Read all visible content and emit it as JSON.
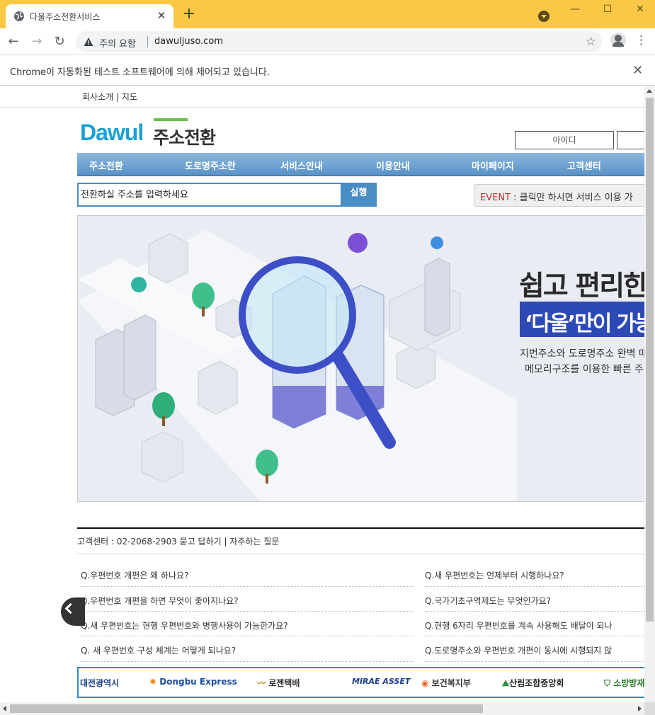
{
  "browser": {
    "tab_title": "다울주소전환서비스",
    "tab_close": "✕",
    "new_tab": "+",
    "security_warning": "주의 요함",
    "url": "dawuljuso.com",
    "infobar_text": "Chrome이 자동화된 테스트 소프트웨어에 의해 제어되고 있습니다.",
    "infobar_close": "✕"
  },
  "site": {
    "top_links": [
      "회사소개",
      "지도"
    ],
    "top_links_sep": " | ",
    "logo_en": "Dawul",
    "logo_ko": "주소전환",
    "login_id_label": "아이디",
    "nav": [
      "주소전환",
      "도로명주소란",
      "서비스안내",
      "이용안내",
      "마이페이지",
      "고객센터"
    ],
    "search_placeholder": "전환하실 주소를 입력하세요",
    "search_button": "실행",
    "event_label": "EVENT",
    "event_text": " : 클릭만 하시면 서비스 이용 가",
    "banner": {
      "headline1": "쉽고 편리한",
      "headline2": "‘다울’만이 가능한",
      "sub1": "지번주소와 도로명주소 완벽 매",
      "sub2": "메모리구조를 이용한 빠른 주"
    },
    "cs_text": "고객센터 : 02-2068-2903 묻고 답하기 | 자주하는 질문",
    "faq_left": [
      "Q.우편번호 개편은 왜 하나요?",
      "Q.우편번호 개편을 하면 무엇이 좋아지나요?",
      "Q.새 우편번호는 현행 우편번호와 병행사용이 가능한가요?",
      "Q. 새 우편번호 구성 체계는 어떻게 되나요?"
    ],
    "faq_right": [
      "Q.새 우편번호는 언제부터 시행하나요?",
      "Q.국가기초구역제도는 무엇인가요?",
      "Q.현행 6자리 우편번호를 계속 사용해도 배달이 되나",
      "Q.도로명주소와 우편번호 개편이 동시에 시행되지 않"
    ],
    "partners": [
      "대전광역시",
      "Dongbu Express",
      "로젠택배",
      "MIRAE ASSET",
      "보건복지부",
      "산림조합중앙회",
      "소방방재"
    ],
    "colors": {
      "chrome_frame": "#fbc845",
      "nav_bar": "#5b93c7",
      "logo_blue": "#1aa1d6",
      "logo_green": "#6cbf45",
      "banner_accent": "#2d49b5",
      "event_red": "#c0302a"
    }
  }
}
